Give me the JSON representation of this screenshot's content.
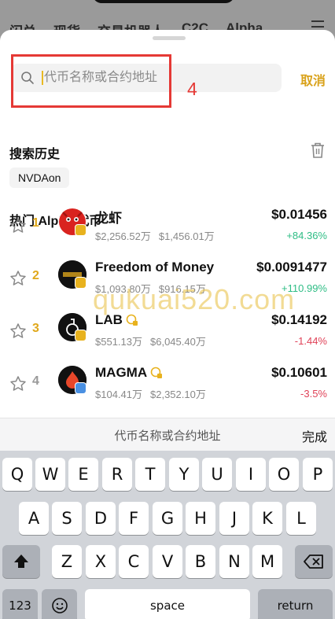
{
  "background_app": {
    "tabs": [
      "闪兑",
      "现货",
      "交易机器人",
      "C2C",
      "Alpha"
    ]
  },
  "search": {
    "placeholder": "代币名称或合约地址",
    "value": "",
    "cancel_label": "取消"
  },
  "annotation": {
    "number": "4",
    "color": "#e53935"
  },
  "history": {
    "title": "搜索历史",
    "items": [
      "NVDAon"
    ]
  },
  "hot": {
    "title": "热门 Alpha 代币",
    "items": [
      {
        "rank": "1",
        "name": "龙虾",
        "market_cap": "$2,256.52万",
        "volume": "$1,456.01万",
        "price": "$0.01456",
        "change": "+84.36%",
        "direction": "up",
        "icon": "lobster-logo"
      },
      {
        "rank": "2",
        "name": "Freedom of Money",
        "market_cap": "$1,093.80万",
        "volume": "$916.15万",
        "price": "$0.0091477",
        "change": "+110.99%",
        "direction": "up",
        "icon": "freedom-of-money-logo"
      },
      {
        "rank": "3",
        "name": "LAB",
        "market_cap": "$551.13万",
        "volume": "$6,045.40万",
        "price": "$0.14192",
        "change": "-1.44%",
        "direction": "down",
        "icon": "lab-flask-logo"
      },
      {
        "rank": "4",
        "name": "MAGMA",
        "market_cap": "$104.41万",
        "volume": "$2,352.10万",
        "price": "$0.10601",
        "change": "-3.5%",
        "direction": "down",
        "icon": "magma-flame-logo"
      }
    ]
  },
  "watermark": "qukuai520.com",
  "keyboard": {
    "bar_placeholder": "代币名称或合约地址",
    "done_label": "完成",
    "row1": [
      "Q",
      "W",
      "E",
      "R",
      "T",
      "Y",
      "U",
      "I",
      "O",
      "P"
    ],
    "row2": [
      "A",
      "S",
      "D",
      "F",
      "G",
      "H",
      "J",
      "K",
      "L"
    ],
    "row3": [
      "Z",
      "X",
      "C",
      "V",
      "B",
      "N",
      "M"
    ],
    "numbers_label": "123",
    "space_label": "space",
    "return_label": "return"
  },
  "colors": {
    "accent": "#e0a81b",
    "up": "#2ebd85",
    "down": "#e04258"
  }
}
